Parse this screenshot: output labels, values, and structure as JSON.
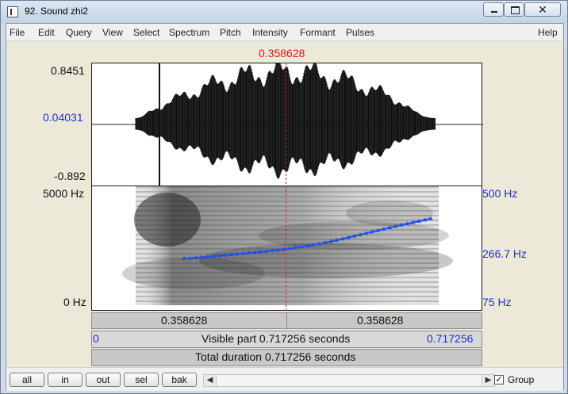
{
  "window": {
    "title": "92. Sound zhi2"
  },
  "menu": [
    "File",
    "Edit",
    "Query",
    "View",
    "Select",
    "Spectrum",
    "Pitch",
    "Intensity",
    "Formant",
    "Pulses"
  ],
  "help": "Help",
  "top_cursor": "0.358628",
  "amplitude": {
    "max": "0.8451",
    "mid": "0.04031",
    "min": "-0.892"
  },
  "spectrogram": {
    "freq_max": "5000 Hz",
    "freq_min": "0 Hz"
  },
  "pitch": {
    "top": "500 Hz",
    "mid": "266.7 Hz",
    "bottom": "75 Hz"
  },
  "selection": {
    "left": "0.358628",
    "right": "0.358628"
  },
  "visible_part": {
    "start": "0",
    "label": "Visible part 0.717256 seconds",
    "end": "0.717256"
  },
  "total_duration": "Total duration 0.717256 seconds",
  "buttons": {
    "all": "all",
    "in": "in",
    "out": "out",
    "sel": "sel",
    "bak": "bak"
  },
  "group_label": "Group",
  "group_checked": true,
  "colors": {
    "cursor": "#d02020",
    "pitch": "#2450e8",
    "blue_text": "#2030c8"
  },
  "icons": {
    "window": "praat-window-icon",
    "minimize": "minimize-icon",
    "maximize": "maximize-icon",
    "close": "close-icon",
    "scroll_left": "scroll-left-icon",
    "scroll_right": "scroll-right-icon",
    "checkbox": "check-icon"
  }
}
